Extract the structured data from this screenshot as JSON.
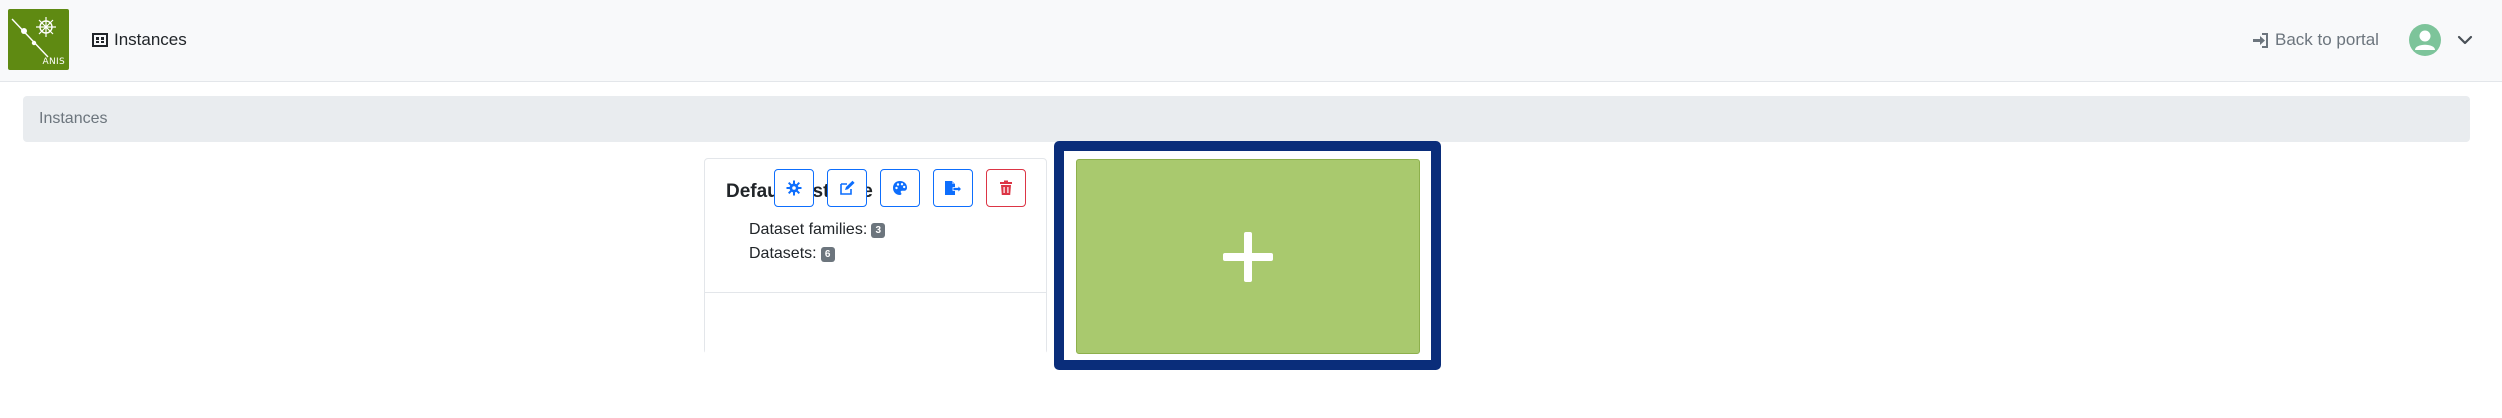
{
  "navbar": {
    "logo_text": "ANIS",
    "brand_label": "Instances",
    "back_to_portal_label": "Back to portal"
  },
  "breadcrumb": {
    "current": "Instances"
  },
  "instance_card": {
    "title": "Default instance",
    "dataset_families_label": "Dataset families:",
    "dataset_families_count": "3",
    "datasets_label": "Datasets:",
    "datasets_count": "6",
    "actions": [
      "settings-icon",
      "edit-icon",
      "palette-icon",
      "export-icon",
      "trash-icon"
    ]
  },
  "add_tile": {
    "icon": "plus-icon"
  },
  "colors": {
    "primary": "#0d6efd",
    "danger": "#dc3545",
    "add_tile_bg": "#a9c96e",
    "highlight_border": "#0a2d7a",
    "logo_bg": "#5f8a12",
    "avatar_bg": "#7dc49a"
  }
}
